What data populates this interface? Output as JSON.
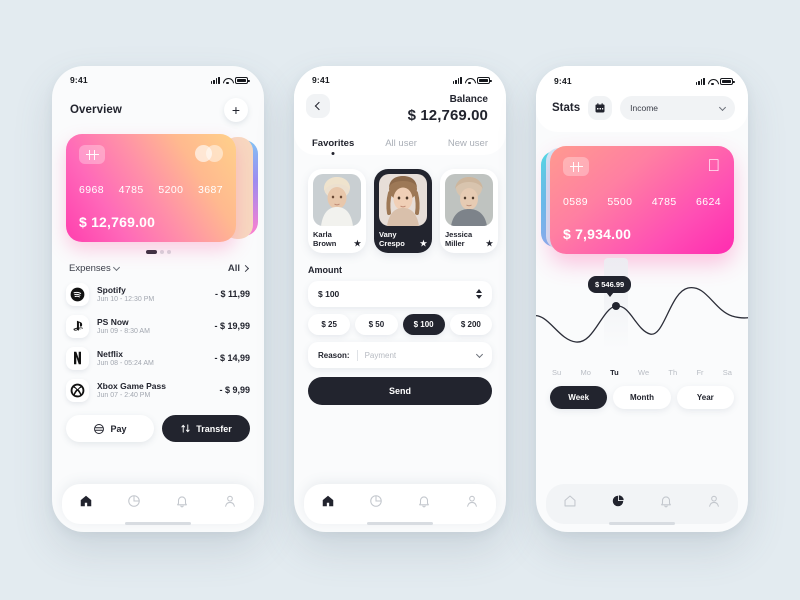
{
  "background_color": "#e3ebf0",
  "accent_dark": "#22242e",
  "screen1": {
    "status": {
      "time": "9:41",
      "icons": [
        "signal-icon",
        "wifi-icon",
        "battery-icon"
      ]
    },
    "title": "Overview",
    "add_button_label": "+",
    "card": {
      "numbers": [
        "6968",
        "4785",
        "5200",
        "3687"
      ],
      "balance": "$ 12,769.00",
      "gradient_from": "#ff3fae",
      "gradient_to": "#ffd18a",
      "chip_icon": "card-chip-icon",
      "brand_icon": "mastercard-icon"
    },
    "pager": {
      "total": 3,
      "active": 1
    },
    "expenses_label": "Expenses",
    "all_label": "All",
    "expenses": [
      {
        "icon": "spotify-icon",
        "name": "Spotify",
        "date": "Jun 10 - 12:30 PM",
        "amount": "- $ 11,99"
      },
      {
        "icon": "playstation-icon",
        "name": "PS Now",
        "date": "Jun 09 - 8:30 AM",
        "amount": "- $ 19,99"
      },
      {
        "icon": "netflix-icon",
        "name": "Netflix",
        "date": "Jun 08 - 05:24 AM",
        "amount": "- $ 14,99"
      },
      {
        "icon": "xbox-icon",
        "name": "Xbox Game Pass",
        "date": "Jun 07 - 2:40 PM",
        "amount": "- $ 9,99"
      }
    ],
    "actions": {
      "pay": "Pay",
      "transfer": "Transfer"
    },
    "tabs": [
      "home-icon",
      "chart-icon",
      "bell-icon",
      "user-icon"
    ],
    "active_tab": 0
  },
  "screen2": {
    "status": {
      "time": "9:41"
    },
    "back_icon": "chevron-left-icon",
    "balance_label": "Balance",
    "balance_value": "$ 12,769.00",
    "tabs": [
      "Favorites",
      "All user",
      "New user"
    ],
    "active_tab": 0,
    "users": [
      {
        "name": "Karla\nBrown",
        "first": "Karla",
        "last": "Brown",
        "starred": true,
        "selected": false
      },
      {
        "name": "Vany\nCrespo",
        "first": "Vany",
        "last": "Crespo",
        "starred": true,
        "selected": true
      },
      {
        "name": "Jessica\nMiller",
        "first": "Jessica",
        "last": "Miller",
        "starred": true,
        "selected": false
      }
    ],
    "amount_label": "Amount",
    "amount_value": "$ 100",
    "quick_amounts": [
      "$ 25",
      "$ 50",
      "$ 100",
      "$ 200"
    ],
    "active_quick_amount": 2,
    "reason_label": "Reason:",
    "reason_placeholder": "Payment",
    "send_label": "Send",
    "tabs_bottom": [
      "home-icon",
      "chart-icon",
      "bell-icon",
      "user-icon"
    ],
    "active_bottom_tab": 0
  },
  "screen3": {
    "status": {
      "time": "9:41"
    },
    "title": "Stats",
    "calendar_icon": "calendar-icon",
    "filter_value": "Income",
    "card": {
      "numbers": [
        "0589",
        "5500",
        "4785",
        "6624"
      ],
      "balance": "$ 7,934.00",
      "brand_icon": "apple-icon",
      "gradient_from": "#ff8f9e",
      "gradient_to": "#ff2bb0"
    },
    "tooltip_value": "$ 546.99",
    "days": [
      "Su",
      "Mo",
      "Tu",
      "We",
      "Th",
      "Fr",
      "Sa"
    ],
    "active_day": 2,
    "ranges": [
      "Week",
      "Month",
      "Year"
    ],
    "active_range": 0,
    "tabs_bottom": [
      "home-icon",
      "chart-icon",
      "bell-icon",
      "user-icon"
    ],
    "active_bottom_tab": 1
  },
  "chart_data": {
    "type": "line",
    "title": "",
    "x": [
      "Su",
      "Mo",
      "Tu",
      "We",
      "Th",
      "Fr",
      "Sa"
    ],
    "values": [
      46,
      74,
      18,
      60,
      66,
      14,
      34
    ],
    "highlight_index": 2,
    "highlight_label": "$ 546.99",
    "grid": false,
    "legend": "none",
    "line_color": "#22242e"
  }
}
